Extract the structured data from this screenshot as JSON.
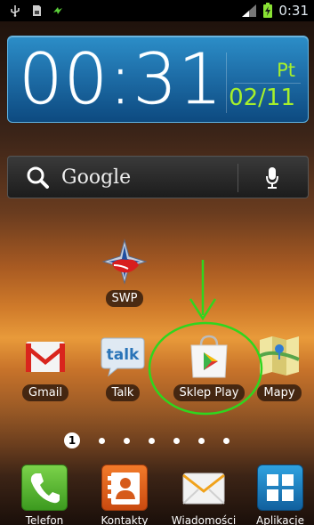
{
  "status_bar": {
    "time": "0:31",
    "icons": [
      "usb-icon",
      "sdcard-icon",
      "sync-icon",
      "signal-icon",
      "battery-charging-icon"
    ]
  },
  "clock_widget": {
    "time": "00:31",
    "day": "Pt",
    "date": "02/11"
  },
  "search_bar": {
    "label": "Google",
    "icons": [
      "search-icon",
      "microphone-icon"
    ]
  },
  "home_apps": [
    {
      "label": "SWP",
      "icon": "swp-compass-icon"
    },
    {
      "label": "Gmail",
      "icon": "gmail-icon"
    },
    {
      "label": "Talk",
      "icon": "talk-icon"
    },
    {
      "label": "Sklep Play",
      "icon": "play-store-icon",
      "highlighted": true
    },
    {
      "label": "Mapy",
      "icon": "maps-icon"
    }
  ],
  "pager": {
    "current": "1",
    "total_dots": 7
  },
  "dock": [
    {
      "label": "Telefon",
      "icon": "phone-icon"
    },
    {
      "label": "Kontakty",
      "icon": "contacts-icon"
    },
    {
      "label": "Wiadomości",
      "icon": "messages-icon"
    },
    {
      "label": "Aplikacje",
      "icon": "apps-grid-icon"
    }
  ],
  "colors": {
    "clock_accent": "#a6f02b",
    "annotation": "#2fd61e"
  }
}
